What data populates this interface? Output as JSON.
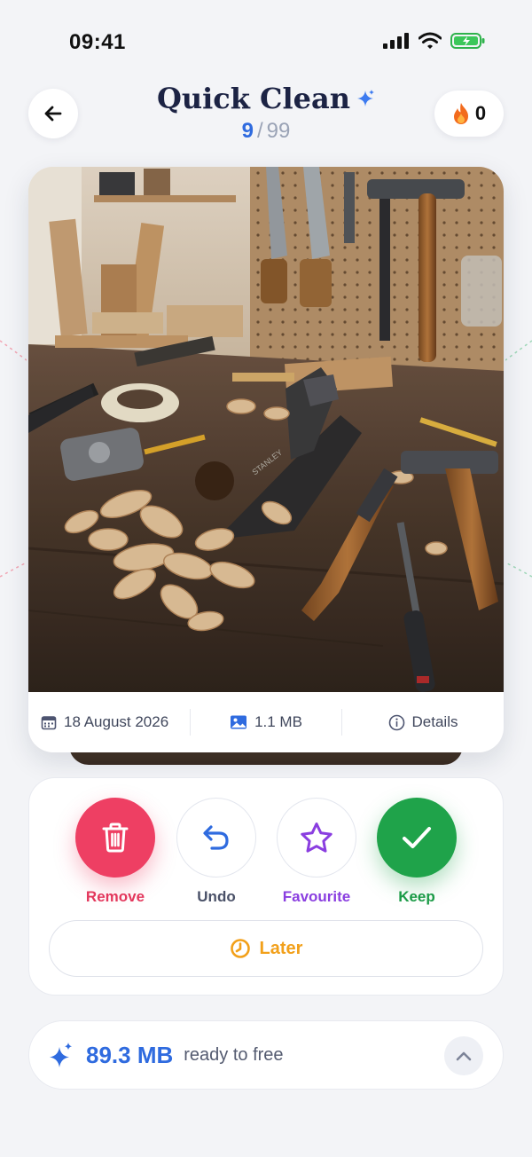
{
  "status_bar": {
    "time": "09:41"
  },
  "header": {
    "title": "Quick Clean",
    "progress_current": "9",
    "progress_separator": "/",
    "progress_total": "99",
    "streak_count": "0"
  },
  "photo": {
    "date": "18 August 2026",
    "size": "1.1 MB",
    "details_label": "Details",
    "overlay_text": "STANLEY"
  },
  "actions": {
    "remove_label": "Remove",
    "undo_label": "Undo",
    "favourite_label": "Favourite",
    "keep_label": "Keep",
    "later_label": "Later"
  },
  "summary": {
    "value": "89.3 MB",
    "text": "ready to free"
  },
  "colors": {
    "accent_blue": "#2f6bdf",
    "remove_red": "#ee3f63",
    "keep_green": "#1fa34a",
    "favourite_purple": "#8a3ee0",
    "later_orange": "#f2a01a",
    "streak_flame": "#f26b1d"
  },
  "icons": [
    "back-arrow-icon",
    "sparkle-icon",
    "flame-icon",
    "calendar-icon",
    "image-icon",
    "info-icon",
    "trash-icon",
    "undo-icon",
    "star-icon",
    "check-icon",
    "clock-icon",
    "chevron-up-icon",
    "signal-icon",
    "wifi-icon",
    "battery-icon"
  ]
}
